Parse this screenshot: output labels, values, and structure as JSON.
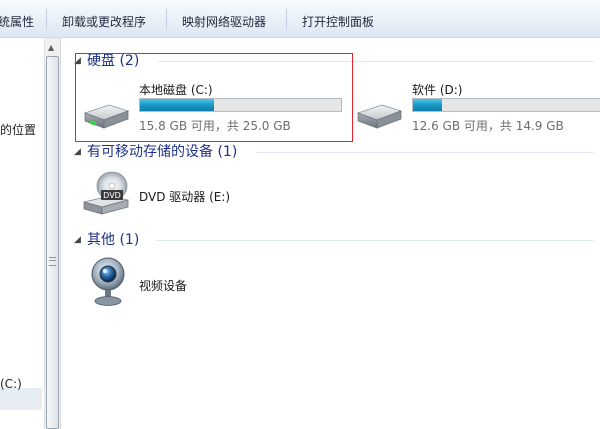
{
  "toolbar": {
    "items": [
      "统属性",
      "卸载或更改程序",
      "映射网络驱动器",
      "打开控制面板"
    ]
  },
  "nav": {
    "location_label": "的位置",
    "drive_label": "(C:)"
  },
  "groups": {
    "hard_disks": {
      "title": "硬盘 (2)",
      "drives": [
        {
          "name": "本地磁盘 (C:)",
          "info": "15.8 GB 可用，共 25.0 GB",
          "used_fraction": 0.368
        },
        {
          "name": "软件 (D:)",
          "info": "12.6 GB 可用，共 14.9 GB",
          "used_fraction": 0.154
        }
      ]
    },
    "removable": {
      "title": "有可移动存储的设备 (1)",
      "items": [
        {
          "name": "DVD 驱动器 (E:)",
          "icon_label": "DVD"
        }
      ]
    },
    "other": {
      "title": "其他 (1)",
      "items": [
        {
          "name": "视频设备"
        }
      ]
    }
  },
  "colors": {
    "group_title": "#1e3287",
    "usage_bar": "#1d9cc8",
    "highlight_box": "#e8232c"
  }
}
